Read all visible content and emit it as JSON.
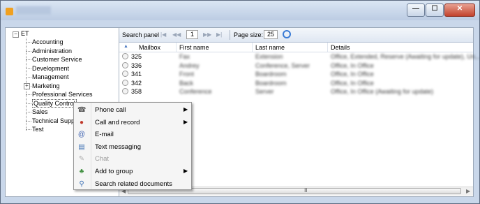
{
  "window": {
    "title": "",
    "min_glyph": "—",
    "max_glyph": "☐",
    "close_glyph": "✕"
  },
  "tree": {
    "root_label": "ET",
    "root_expander": "⊟",
    "items": [
      {
        "label": "Accounting"
      },
      {
        "label": "Administration"
      },
      {
        "label": "Customer Service"
      },
      {
        "label": "Development"
      },
      {
        "label": "Management"
      },
      {
        "label": "Marketing",
        "expander": "⊞"
      },
      {
        "label": "Professional Services"
      },
      {
        "label": "Quality Control",
        "selected": true
      },
      {
        "label": "Sales"
      },
      {
        "label": "Technical Support"
      },
      {
        "label": "Test"
      }
    ]
  },
  "toolbar": {
    "search_label": "Search panel",
    "first_icon": "|◀",
    "prev_icon": "◀◀",
    "page_value": "1",
    "next_icon": "▶▶",
    "last_icon": "▶|",
    "page_size_label": "Page size:",
    "page_size_value": "25"
  },
  "grid": {
    "columns": [
      "Mailbox",
      "First name",
      "Last name",
      "Details"
    ],
    "rows": [
      {
        "mailbox": "325",
        "first": "Fax",
        "last": "Extension",
        "details": "Office, Extended, Reserve (Awaiting for update), Un..."
      },
      {
        "mailbox": "336",
        "first": "Andrey",
        "last": "Conference, Server",
        "details": "Office, In Office"
      },
      {
        "mailbox": "341",
        "first": "Front",
        "last": "Boardroom",
        "details": "Office, In Office"
      },
      {
        "mailbox": "342",
        "first": "Back",
        "last": "Boardroom",
        "details": "Office, In Office"
      },
      {
        "mailbox": "358",
        "first": "Conference",
        "last": "Server",
        "details": "Office, In Office (Awaiting for update)"
      }
    ],
    "scroll_grip": "III"
  },
  "context_menu": {
    "items": [
      {
        "label": "Phone call",
        "icon": "phone-icon",
        "glyph": "☎",
        "submenu": true,
        "disabled": false,
        "color": "#555555"
      },
      {
        "label": "Call and record",
        "icon": "call-record-icon",
        "glyph": "●",
        "submenu": true,
        "disabled": false,
        "color": "#c0392b"
      },
      {
        "label": "E-mail",
        "icon": "email-icon",
        "glyph": "@",
        "submenu": false,
        "disabled": false,
        "color": "#3a5fb0"
      },
      {
        "label": "Text messaging",
        "icon": "text-message-icon",
        "glyph": "▤",
        "submenu": false,
        "disabled": false,
        "color": "#4a79b8"
      },
      {
        "label": "Chat",
        "icon": "chat-icon",
        "glyph": "✎",
        "submenu": false,
        "disabled": true,
        "color": "#b0b0b0"
      },
      {
        "label": "Add to group",
        "icon": "group-icon",
        "glyph": "♣",
        "submenu": true,
        "disabled": false,
        "color": "#3f8f3f"
      },
      {
        "label": "Search related documents",
        "icon": "search-documents-icon",
        "glyph": "⚲",
        "submenu": false,
        "disabled": false,
        "color": "#3a6fb5"
      }
    ],
    "submenu_arrow": "▶"
  }
}
